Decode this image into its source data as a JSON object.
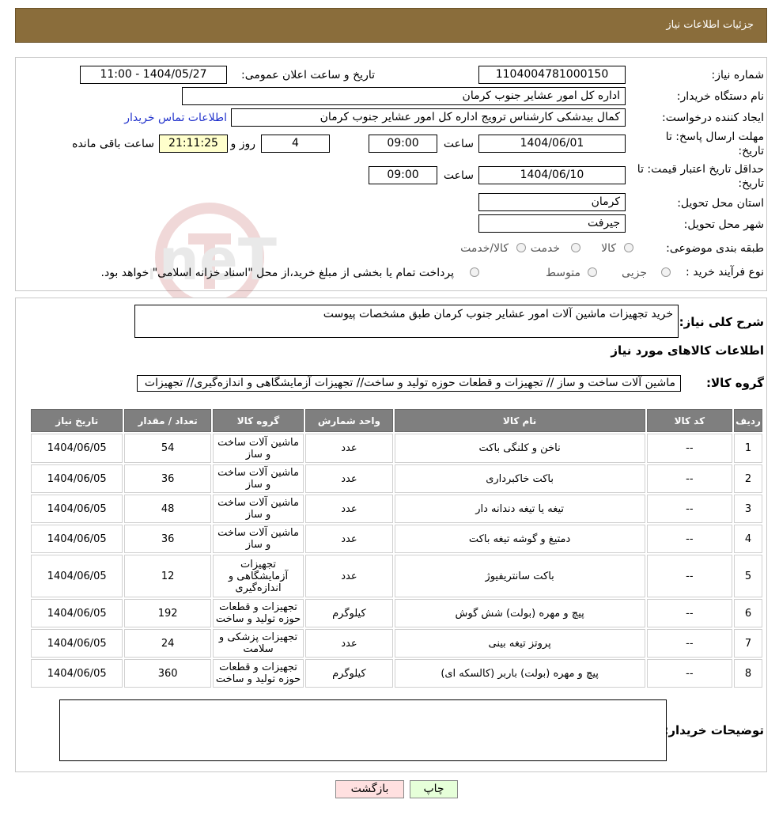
{
  "page_title": "جزئیات اطلاعات نیاز",
  "watermark": "AriaTender.neT",
  "fields": {
    "need_number_label": "شماره نیاز:",
    "need_number": "1104004781000150",
    "announce_label": "تاریخ و ساعت اعلان عمومی:",
    "announce_value": "1404/05/27 - 11:00",
    "buyer_org_label": "نام دستگاه خریدار:",
    "buyer_org": "اداره کل امور عشایر جنوب کرمان",
    "creator_label": "ایجاد کننده درخواست:",
    "creator": "کمال بیدشکی کارشناس ترویج اداره کل امور عشایر جنوب کرمان",
    "contact_link": "اطلاعات تماس خریدار",
    "deadline_label_1": "مهلت ارسال پاسخ: تا",
    "deadline_label_2": "تاریخ:",
    "deadline_date": "1404/06/01",
    "time_label": "ساعت",
    "deadline_time": "09:00",
    "days_value": "4",
    "days_label": "روز و",
    "remaining_time": "21:11:25",
    "remaining_label": "ساعت باقی مانده",
    "validity_label_1": "حداقل تاریخ اعتبار قیمت: تا",
    "validity_label_2": "تاریخ:",
    "validity_date": "1404/06/10",
    "validity_time": "09:00",
    "province_label": "استان محل تحویل:",
    "province": "کرمان",
    "city_label": "شهر محل تحویل:",
    "city": "جیرفت",
    "category_label": "طبقه بندی موضوعی:",
    "category_options": [
      "کالا",
      "خدمت",
      "کالا/خدمت"
    ],
    "process_label": "نوع فرآیند خرید :",
    "process_options": [
      "جزیی",
      "متوسط"
    ],
    "process_note": "پرداخت تمام یا بخشی از مبلغ خرید،از محل \"اسناد خزانه اسلامی\" خواهد بود."
  },
  "summary": {
    "desc_label": "شرح کلی نیاز:",
    "desc_value": "خرید تجهیزات ماشین آلات  امور عشایر جنوب کرمان طبق مشخصات پیوست",
    "items_title": "اطلاعات کالاهای مورد نیاز",
    "group_label": "گروه کالا:",
    "group_value": "ماشین آلات ساخت و ساز // تجهیزات و قطعات حوزه تولید و ساخت// تجهیزات آزمایشگاهی و اندازه‌گیری// تجهیزات"
  },
  "table": {
    "headers": [
      "ردیف",
      "کد کالا",
      "نام کالا",
      "واحد شمارش",
      "گروه کالا",
      "تعداد / مقدار",
      "تاریخ نیاز"
    ],
    "rows": [
      {
        "idx": "1",
        "code": "--",
        "name": "ناخن و کلنگی باکت",
        "unit": "عدد",
        "group": "ماشین آلات ساخت و ساز",
        "qty": "54",
        "date": "1404/06/05"
      },
      {
        "idx": "2",
        "code": "--",
        "name": "باکت خاکبرداری",
        "unit": "عدد",
        "group": "ماشین آلات ساخت و ساز",
        "qty": "36",
        "date": "1404/06/05"
      },
      {
        "idx": "3",
        "code": "--",
        "name": "تیغه یا تیغه دندانه دار",
        "unit": "عدد",
        "group": "ماشین آلات ساخت و ساز",
        "qty": "48",
        "date": "1404/06/05"
      },
      {
        "idx": "4",
        "code": "--",
        "name": "دمتیغ و گوشه تیغه باکت",
        "unit": "عدد",
        "group": "ماشین آلات ساخت و ساز",
        "qty": "36",
        "date": "1404/06/05"
      },
      {
        "idx": "5",
        "code": "--",
        "name": "باکت سانتریفیوژ",
        "unit": "عدد",
        "group": "تجهیزات آزمایشگاهی و اندازه‌گیری",
        "qty": "12",
        "date": "1404/06/05"
      },
      {
        "idx": "6",
        "code": "--",
        "name": "پیچ و مهره (بولت) شش گوش",
        "unit": "کیلوگرم",
        "group": "تجهیزات و قطعات حوزه تولید و ساخت",
        "qty": "192",
        "date": "1404/06/05"
      },
      {
        "idx": "7",
        "code": "--",
        "name": "پروتز تیغه بینی",
        "unit": "عدد",
        "group": "تجهیزات پزشکی و سلامت",
        "qty": "24",
        "date": "1404/06/05"
      },
      {
        "idx": "8",
        "code": "--",
        "name": "پیچ و مهره (بولت) باربر (کالسکه ای)",
        "unit": "کیلوگرم",
        "group": "تجهیزات و قطعات حوزه تولید و ساخت",
        "qty": "360",
        "date": "1404/06/05"
      }
    ]
  },
  "buyer_notes_label": "توضیحات خریدار:",
  "buttons": {
    "print": "چاپ",
    "back": "بازگشت"
  },
  "colors": {
    "header_bg": "#8a6d3b",
    "table_header_bg": "#7f7f7f",
    "print_btn": "#e6ffd9",
    "back_btn": "#ffe0e0"
  }
}
